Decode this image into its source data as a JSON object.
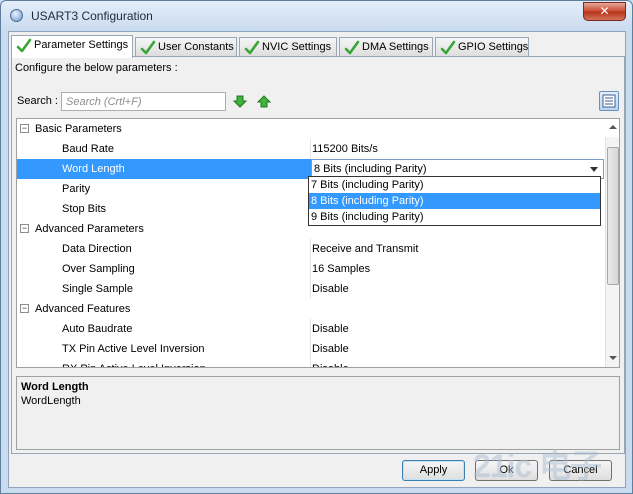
{
  "window": {
    "title": "USART3 Configuration",
    "close_label": "✕"
  },
  "tabs": [
    {
      "label": "Parameter Settings",
      "active": true
    },
    {
      "label": "User Constants",
      "active": false
    },
    {
      "label": "NVIC Settings",
      "active": false
    },
    {
      "label": "DMA Settings",
      "active": false
    },
    {
      "label": "GPIO Settings",
      "active": false
    }
  ],
  "panel": {
    "configure_text": "Configure the below parameters :",
    "search_label": "Search :",
    "search_placeholder": "Search (Crtl+F)"
  },
  "grid": {
    "basic_group": "Basic Parameters",
    "baud_rate": {
      "name": "Baud Rate",
      "value": "115200 Bits/s"
    },
    "word_length": {
      "name": "Word Length",
      "value": "8 Bits (including Parity)"
    },
    "parity": {
      "name": "Parity",
      "value": ""
    },
    "stop_bits": {
      "name": "Stop Bits",
      "value": ""
    },
    "advanced_group": "Advanced Parameters",
    "data_direction": {
      "name": "Data Direction",
      "value": "Receive and Transmit"
    },
    "over_sampling": {
      "name": "Over Sampling",
      "value": "16 Samples"
    },
    "single_sample": {
      "name": "Single Sample",
      "value": "Disable"
    },
    "features_group": "Advanced Features",
    "auto_baudrate": {
      "name": "Auto Baudrate",
      "value": "Disable"
    },
    "tx_pin": {
      "name": "TX Pin Active Level Inversion",
      "value": "Disable"
    },
    "rx_pin": {
      "name": "RX Pin Active Level Inversion",
      "value": "Disable"
    },
    "toggle_symbol": "−"
  },
  "dropdown": {
    "options": [
      "7 Bits (including Parity)",
      "8 Bits (including Parity)",
      "9 Bits (including Parity)"
    ],
    "highlighted_index": 1
  },
  "description": {
    "title": "Word Length",
    "body": "WordLength"
  },
  "buttons": {
    "apply": "Apply",
    "ok": "Ok",
    "cancel": "Cancel"
  },
  "watermark": "21ic 电子网",
  "colors": {
    "selection": "#3399ff",
    "check_green": "#3aa537"
  }
}
